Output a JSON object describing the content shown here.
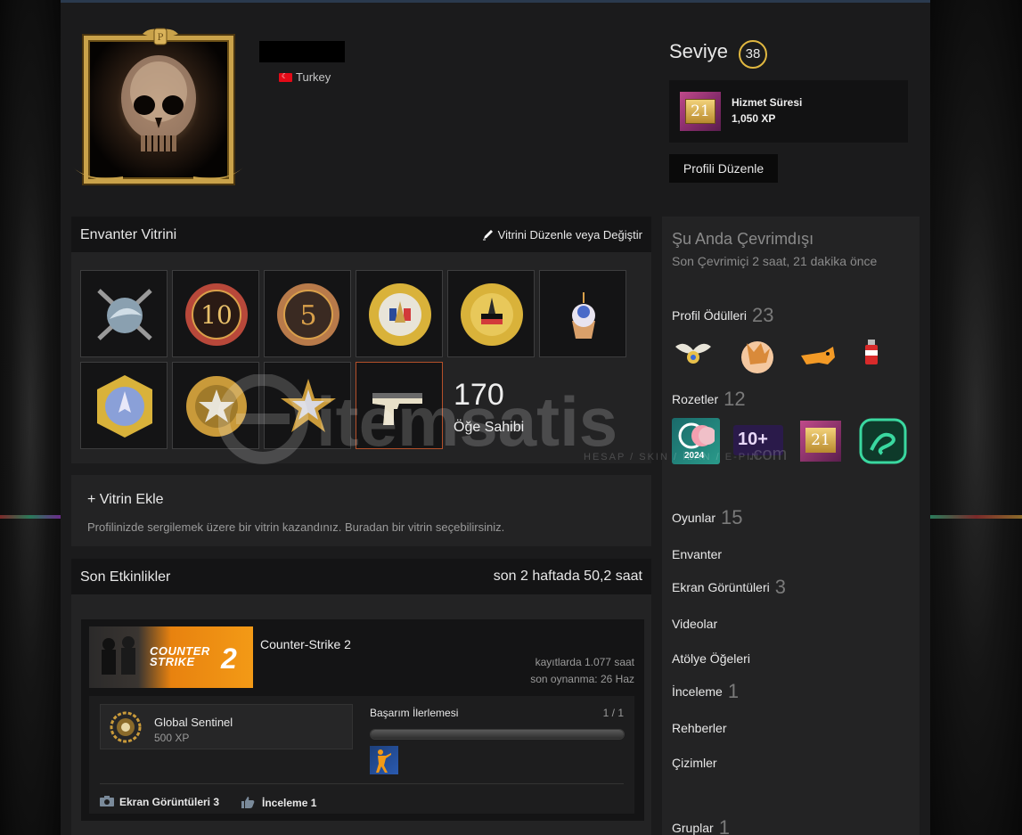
{
  "profile": {
    "country": "Turkey",
    "level_label": "Seviye",
    "level": "38",
    "service_badge_years": "21",
    "service_title": "Hizmet Süresi",
    "service_xp": "1,050 XP",
    "edit_profile_label": "Profili Düzenle"
  },
  "showcase": {
    "title": "Envanter Vitrini",
    "edit_label": "Vitrini Düzenle veya Değiştir",
    "item_count": "170",
    "item_count_label": "Öğe Sahibi"
  },
  "add_showcase": {
    "title": "+ Vitrin Ekle",
    "description": "Profilinizde sergilemek üzere bir vitrin kazandınız. Buradan bir vitrin seçebilirsiniz."
  },
  "activity": {
    "title": "Son Etkinlikler",
    "summary": "son 2 haftada 50,2 saat",
    "game": {
      "name": "Counter-Strike 2",
      "capsule_text_1": "COUNTER",
      "capsule_text_2": "STRIKE",
      "capsule_text_3": "2",
      "hours_on_record": "kayıtlarda 1.077 saat",
      "last_played": "son oynanma: 26 Haz",
      "rank_name": "Global Sentinel",
      "rank_xp": "500 XP",
      "achievement_label": "Başarım İlerlemesi",
      "achievement_count": "1 / 1",
      "achievement_progress": 1.0,
      "screenshots_label": "Ekran Görüntüleri",
      "screenshots_count": "3",
      "reviews_label": "İnceleme",
      "reviews_count": "1"
    }
  },
  "sidebar": {
    "status": "Şu Anda Çevrimdışı",
    "last_online": "Son Çevrimiçi 2 saat, 21 dakika önce",
    "awards_label": "Profil Ödülleri",
    "awards_count": "23",
    "badges_label": "Rozetler",
    "badges_count": "12",
    "badge_year": "2024",
    "badge_10plus": "10+",
    "badge_years": "21",
    "games_label": "Oyunlar",
    "games_count": "15",
    "inventory_label": "Envanter",
    "screenshots_label": "Ekran Görüntüleri",
    "screenshots_count": "3",
    "videos_label": "Videolar",
    "workshop_label": "Atölye Öğeleri",
    "reviews_label": "İnceleme",
    "reviews_count": "1",
    "guides_label": "Rehberler",
    "artwork_label": "Çizimler",
    "groups_label": "Gruplar",
    "groups_count": "1"
  },
  "watermark": {
    "brand": "itemsatis",
    "tagline": "HESAP / SKIN / İLAN / E-PIN",
    "suffix": ".com"
  },
  "colors": {
    "page_bg": "#1b1b1c",
    "panel_bg": "#232324",
    "panel_head": "#141415",
    "level_ring": "#e0b740",
    "selected_tile": "#b5502a",
    "cs_orange": "#f39a16"
  }
}
